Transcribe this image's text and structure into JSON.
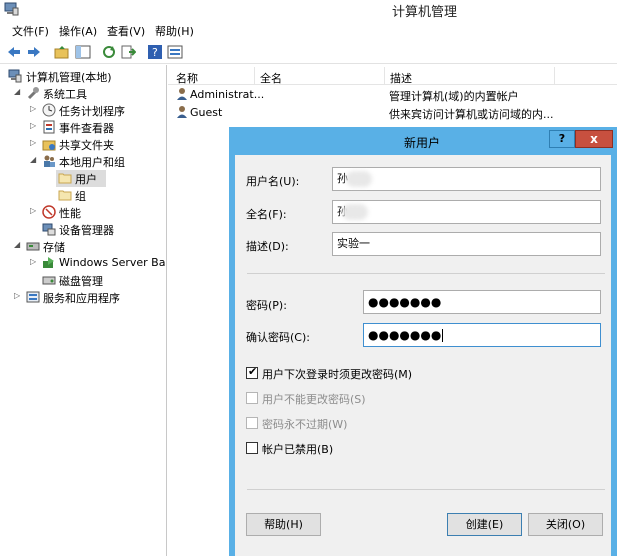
{
  "window": {
    "title": "计算机管理"
  },
  "menu": [
    "文件(F)",
    "操作(A)",
    "查看(V)",
    "帮助(H)"
  ],
  "tree": {
    "root": "计算机管理(本地)",
    "system_tools": "系统工具",
    "task_scheduler": "任务计划程序",
    "event_viewer": "事件查看器",
    "shared_folders": "共享文件夹",
    "local_users_groups": "本地用户和组",
    "users": "用户",
    "groups": "组",
    "performance": "性能",
    "device_manager": "设备管理器",
    "storage": "存储",
    "windows_server_backup": "Windows Server Back",
    "disk_management": "磁盘管理",
    "services_apps": "服务和应用程序"
  },
  "list": {
    "columns": [
      "名称",
      "全名",
      "描述"
    ],
    "rows": [
      {
        "name": "Administrat...",
        "fullname": "",
        "description": "管理计算机(域)的内置帐户"
      },
      {
        "name": "Guest",
        "fullname": "",
        "description": "供来宾访问计算机或访问域的内..."
      }
    ]
  },
  "dialog": {
    "title": "新用户",
    "help_glyph": "?",
    "close_glyph": "x",
    "username_label": "用户名(U):",
    "username_value": "孙",
    "fullname_label": "全名(F):",
    "fullname_value": "孙",
    "description_label": "描述(D):",
    "description_value": "实验一",
    "password_label": "密码(P):",
    "password_value": "●●●●●●●",
    "confirm_label": "确认密码(C):",
    "confirm_value": "●●●●●●●",
    "checkboxes": [
      {
        "label": "用户下次登录时须更改密码(M)",
        "checked": true,
        "enabled": true
      },
      {
        "label": "用户不能更改密码(S)",
        "checked": false,
        "enabled": false
      },
      {
        "label": "密码永不过期(W)",
        "checked": false,
        "enabled": false
      },
      {
        "label": "帐户已禁用(B)",
        "checked": false,
        "enabled": true
      }
    ],
    "help_button": "帮助(H)",
    "create_button": "创建(E)",
    "close_button": "关闭(O)"
  }
}
